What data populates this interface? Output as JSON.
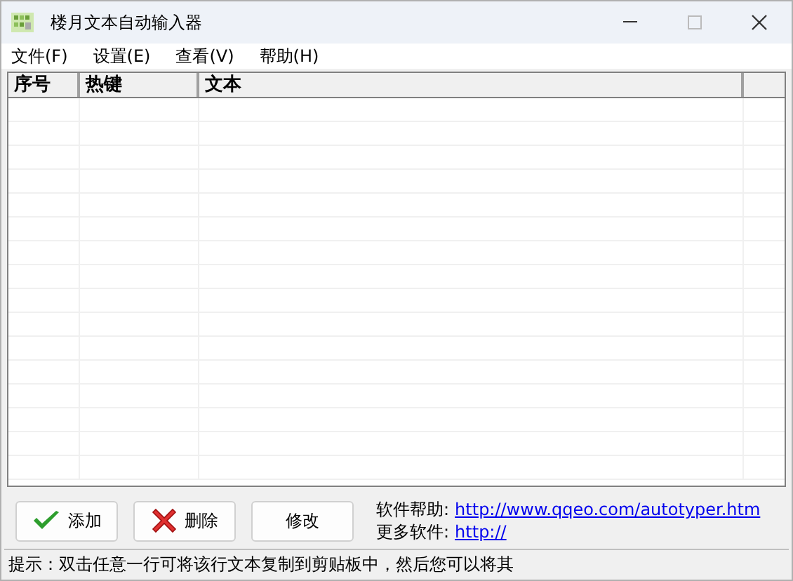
{
  "window": {
    "title": "楼月文本自动输入器"
  },
  "menu": [
    "文件(F)",
    "设置(E)",
    "查看(V)",
    "帮助(H)"
  ],
  "table": {
    "columns": [
      "序号",
      "热键",
      "文本"
    ]
  },
  "buttons": [
    {
      "kind": "add",
      "label": "添加"
    },
    {
      "kind": "delete",
      "label": "删除"
    },
    {
      "kind": "plain",
      "label": "修改"
    }
  ],
  "links": [
    {
      "label": "软件帮助:",
      "url": "http://www.qqeo.com/autotyper.htm"
    },
    {
      "label": "更多软件:",
      "url": "http://"
    }
  ],
  "status_bar": "提示：双击任意一行可将该行文本复制到剪贴板中，然后您可以将其"
}
